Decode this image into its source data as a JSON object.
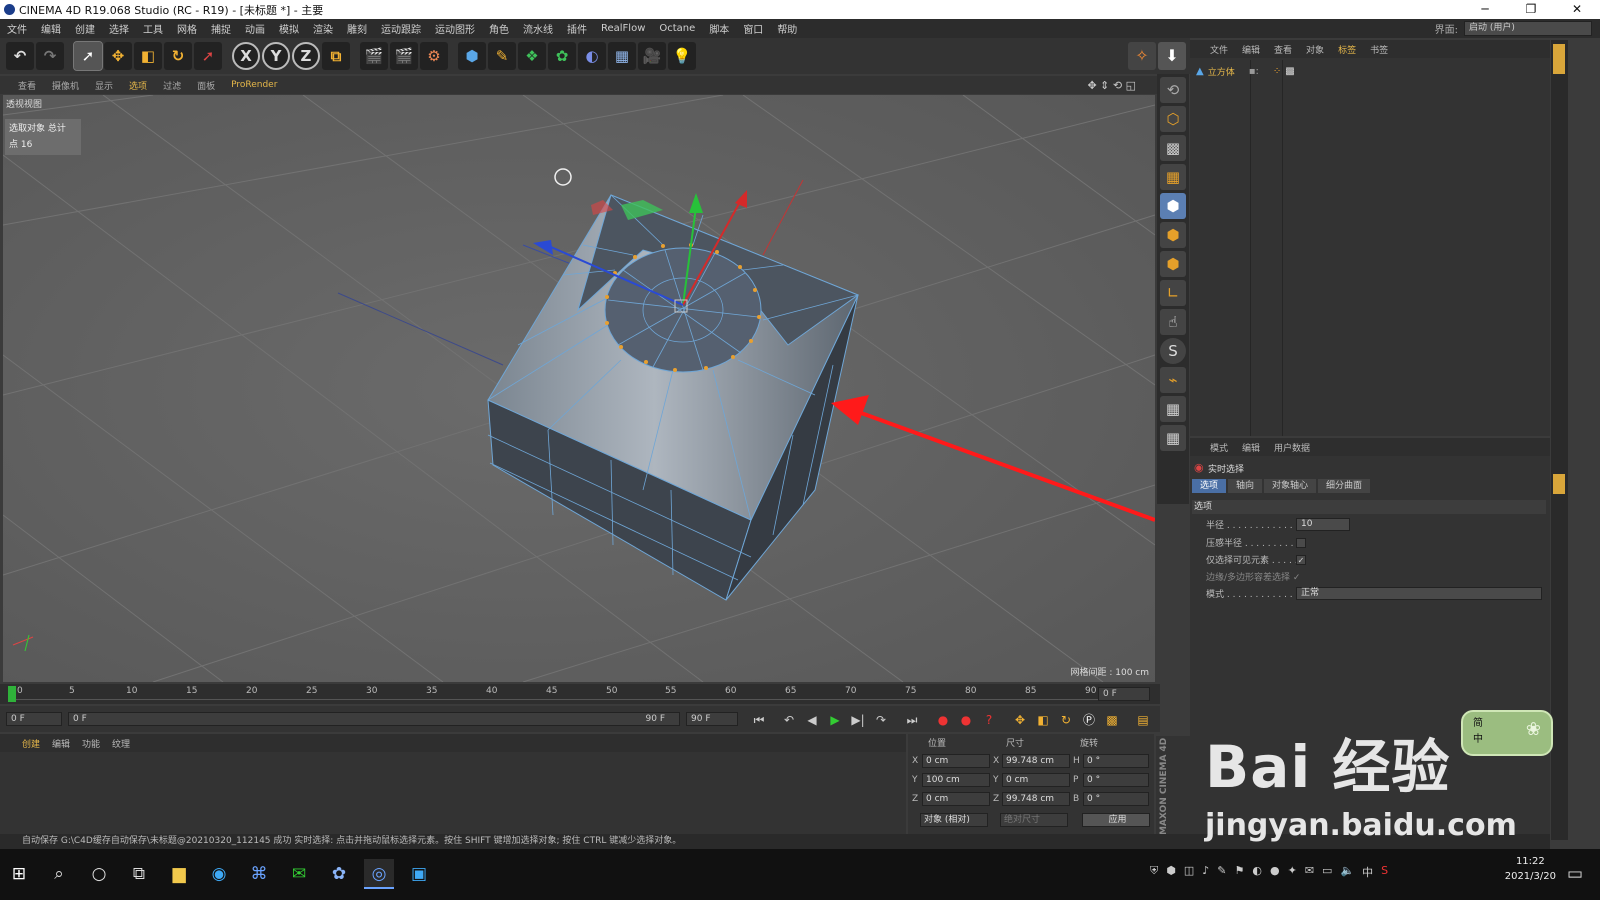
{
  "window": {
    "title": "CINEMA 4D R19.068 Studio (RC - R19) - [未标题 *] - 主要",
    "controls": [
      "─",
      "❐",
      "✕"
    ]
  },
  "menu": {
    "items": [
      "文件",
      "编辑",
      "创建",
      "选择",
      "工具",
      "网格",
      "捕捉",
      "动画",
      "模拟",
      "渲染",
      "雕刻",
      "运动跟踪",
      "运动图形",
      "角色",
      "流水线",
      "插件",
      "RealFlow",
      "Octane",
      "脚本",
      "窗口",
      "帮助"
    ],
    "layout_label": "界面:",
    "layout_value": "启动 (用户)"
  },
  "toolbar": {
    "undo": "↶",
    "redo": "↷",
    "axes": [
      "X",
      "Y",
      "Z"
    ]
  },
  "viewport_menu": {
    "items": [
      "查看",
      "摄像机",
      "显示",
      "选项",
      "过滤",
      "面板",
      "ProRender"
    ]
  },
  "viewport": {
    "title": "透视视图",
    "hud_line1": "选取对象 总计",
    "hud_line2": "点  16",
    "grid_spacing": "网格间距 : 100 cm"
  },
  "object_manager": {
    "menu": [
      "文件",
      "编辑",
      "查看",
      "对象",
      "标签",
      "书签"
    ],
    "object_name": "立方体"
  },
  "attributes": {
    "menu": [
      "模式",
      "编辑",
      "用户数据"
    ],
    "tool_title": "实时选择",
    "tabs": [
      "选项",
      "轴向",
      "对象轴心",
      "细分曲面"
    ],
    "section": "选项",
    "radius_label": "半径 . . . . . . . . . . . . . .",
    "radius_value": "10",
    "pressure_label": "压感半径 . . . . . . . . . .",
    "visible_label": "仅选择可见元素 . . . . . . .",
    "visible_check": "✓",
    "edge_label": "边缘/多边形容差选择 ✓",
    "mode_label": "模式 . . . . . . . . . . . . . .",
    "mode_value": "正常"
  },
  "timeline": {
    "ticks": [
      "0",
      "5",
      "10",
      "15",
      "20",
      "25",
      "30",
      "35",
      "40",
      "45",
      "50",
      "55",
      "60",
      "65",
      "70",
      "75",
      "80",
      "85",
      "90"
    ],
    "frame": "0 F"
  },
  "transport": {
    "start": "0 F",
    "slider_start": "0 F",
    "slider_end": "90 F",
    "end": "90 F"
  },
  "materials": {
    "menu": [
      "创建",
      "编辑",
      "功能",
      "纹理"
    ]
  },
  "coords": {
    "h_pos": "位置",
    "h_size": "尺寸",
    "h_rot": "旋转",
    "x_pos": "0 cm",
    "y_pos": "100 cm",
    "z_pos": "0 cm",
    "x_size": "99.748 cm",
    "y_size": "0 cm",
    "z_size": "99.748 cm",
    "h_rot_v": "0 °",
    "p_rot_v": "0 °",
    "b_rot_v": "0 °",
    "mode1": "对象 (相对)",
    "mode2": "绝对尺寸",
    "apply": "应用",
    "lx": "X",
    "ly": "Y",
    "lz": "Z",
    "lh": "H",
    "lp": "P",
    "lb": "B"
  },
  "brand": "MAXON CINEMA 4D",
  "status": "自动保存 G:\\C4D缓存自动保存\\未标题@20210320_112145 成功    实时选择: 点击并拖动鼠标选择元素。按住 SHIFT 键增加选择对象; 按住 CTRL 键减少选择对象。",
  "taskbar": {
    "time": "11:22",
    "date": "2021/3/20",
    "ime": "中"
  },
  "watermark": {
    "main": "Bai 经验",
    "url": "jingyan.baidu.com",
    "ime_top": "简",
    "ime_bottom": "中"
  },
  "colors": {
    "accent": "#e5b74a",
    "arrow": "#ff1a1a",
    "x_axis": "#d42a2a",
    "y_axis": "#27c23a",
    "z_axis": "#2a4ad4"
  }
}
